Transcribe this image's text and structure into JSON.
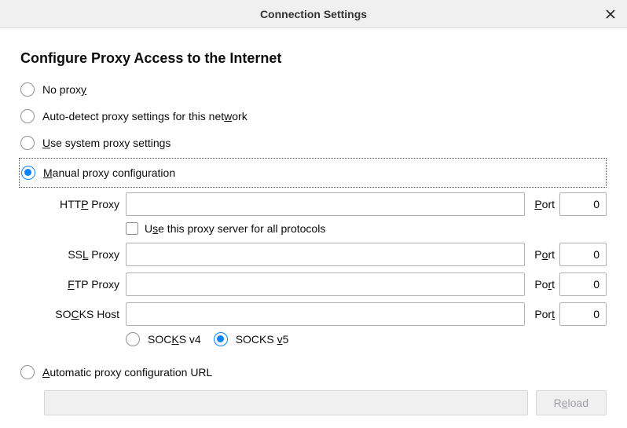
{
  "title": "Connection Settings",
  "heading": "Configure Proxy Access to the Internet",
  "radios": {
    "none_pre": "No prox",
    "none_ul": "y",
    "auto_pre": "Auto-detect proxy settings for this net",
    "auto_ul": "w",
    "auto_post": "ork",
    "sys_ul": "U",
    "sys_post": "se system proxy settings",
    "man_ul": "M",
    "man_post": "anual proxy configuration",
    "pac_ul": "A",
    "pac_post": "utomatic proxy configuration URL"
  },
  "fields": {
    "http_pre": "HTT",
    "http_ul": "P",
    "http_post": " Proxy",
    "ssl_pre": "SS",
    "ssl_ul": "L",
    "ssl_post": " Proxy",
    "ftp_ul": "F",
    "ftp_post": "TP Proxy",
    "socks_pre": "SO",
    "socks_ul": "C",
    "socks_post": "KS Host",
    "port_ul": "P",
    "port_post": "ort",
    "port2_pre": "P",
    "port2_ul": "o",
    "port2_post": "rt",
    "port3_pre": "Po",
    "port3_ul": "r",
    "port3_post": "t",
    "port4_pre": "Por",
    "port4_ul": "t"
  },
  "values": {
    "http": "",
    "http_port": "0",
    "ssl": "",
    "ssl_port": "0",
    "ftp": "",
    "ftp_port": "0",
    "socks": "",
    "socks_port": "0",
    "pac_url": ""
  },
  "checkbox": {
    "pre": "U",
    "ul": "s",
    "post": "e this proxy server for all protocols"
  },
  "socks_v": {
    "v4_pre": "SOC",
    "v4_ul": "K",
    "v4_post": "S v4",
    "v5_pre": "SOCKS ",
    "v5_ul": "v",
    "v5_post": "5"
  },
  "buttons": {
    "reload_pre": "R",
    "reload_ul": "e",
    "reload_post": "load"
  }
}
